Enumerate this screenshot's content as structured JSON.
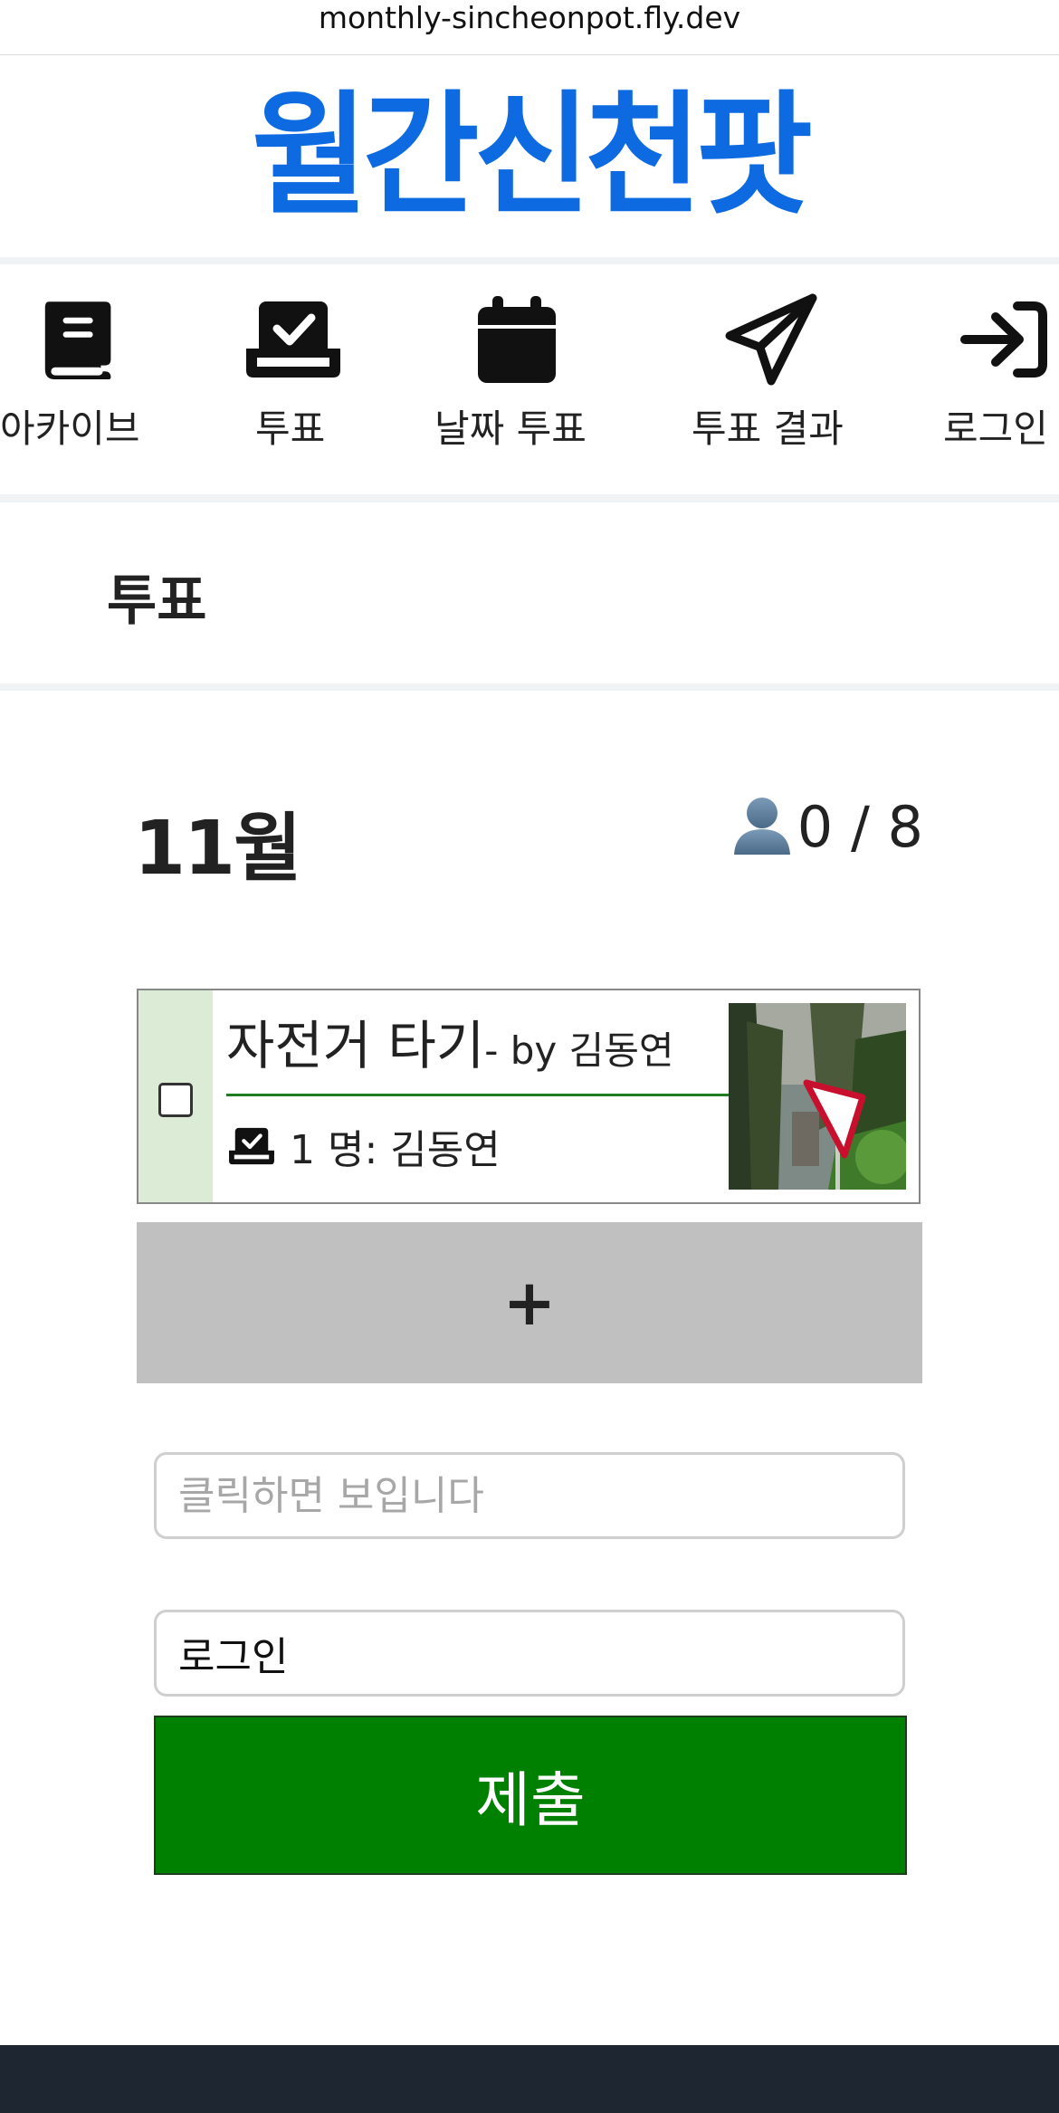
{
  "browser": {
    "url": "monthly-sincheonpot.fly.dev"
  },
  "brand": {
    "title": "월간신천팟",
    "color": "#0d6ae0"
  },
  "nav": {
    "items": [
      {
        "label": "아카이브",
        "icon": "book-icon"
      },
      {
        "label": "투표",
        "icon": "vote-box-icon"
      },
      {
        "label": "날짜 투표",
        "icon": "calendar-icon"
      },
      {
        "label": "투표 결과",
        "icon": "paper-plane-icon"
      },
      {
        "label": "로그인",
        "icon": "login-arrow-icon"
      }
    ]
  },
  "page": {
    "title": "투표"
  },
  "vote": {
    "month": "11월",
    "participants": "0 / 8",
    "participants_icon": "person-icon",
    "options": [
      {
        "title": "자전거 타기",
        "author": "- by 김동연",
        "votes": "1 명: 김동연",
        "checked": false,
        "photo": "bicycle-route-photo"
      }
    ],
    "add_label": "+"
  },
  "form": {
    "password_placeholder": "클릭하면 보입니다",
    "name_value": "로그인",
    "submit_label": "제출"
  },
  "colors": {
    "accent": "#0d6ae0",
    "submit": "#008000",
    "option_check_bg": "#dcebd6",
    "add_button_bg": "#c0c0c0",
    "footer": "#1e2631"
  }
}
